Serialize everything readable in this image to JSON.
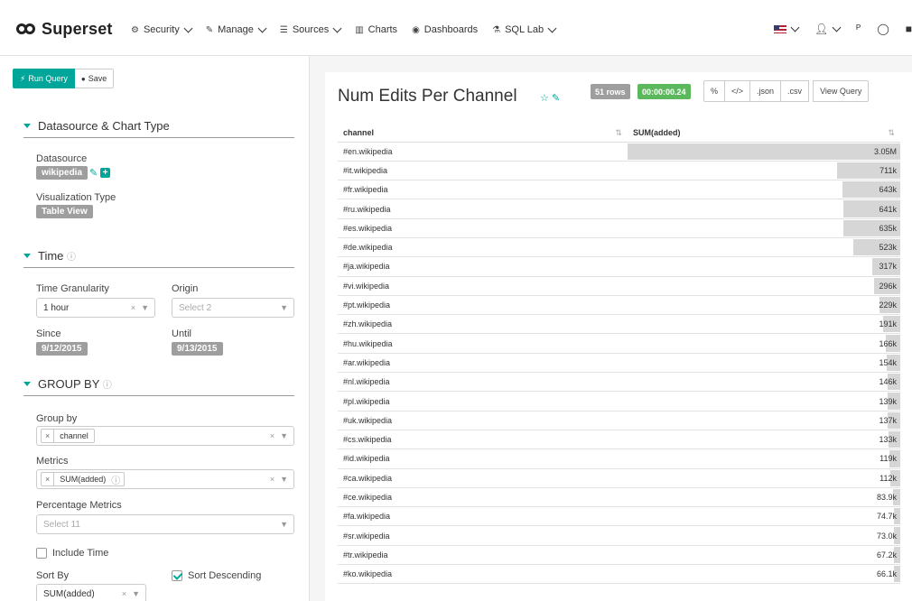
{
  "navbar": {
    "brand": "Superset",
    "items": [
      {
        "icon": "gear-icon",
        "glyph": "⚙",
        "label": "Security",
        "dropdown": true
      },
      {
        "icon": "wrench-icon",
        "glyph": "✎",
        "label": "Manage",
        "dropdown": true
      },
      {
        "icon": "database-icon",
        "glyph": "☰",
        "label": "Sources",
        "dropdown": true
      },
      {
        "icon": "bar-chart-icon",
        "glyph": "▥",
        "label": "Charts",
        "dropdown": false
      },
      {
        "icon": "dashboard-icon",
        "glyph": "◉",
        "label": "Dashboards",
        "dropdown": false
      },
      {
        "icon": "flask-icon",
        "glyph": "⚗",
        "label": "SQL Lab",
        "dropdown": true
      }
    ]
  },
  "left": {
    "run_query": "Run Query",
    "save": "Save",
    "datasource_section": "Datasource & Chart Type",
    "datasource_label": "Datasource",
    "datasource_value": "wikipedia",
    "viz_type_label": "Visualization Type",
    "viz_type_value": "Table View",
    "time_section": "Time",
    "time_granularity_label": "Time Granularity",
    "time_granularity_value": "1 hour",
    "origin_label": "Origin",
    "origin_placeholder": "Select 2",
    "since_label": "Since",
    "since_value": "9/12/2015",
    "until_label": "Until",
    "until_value": "9/13/2015",
    "groupby_section": "GROUP BY",
    "groupby_label": "Group by",
    "groupby_value": "channel",
    "metrics_label": "Metrics",
    "metrics_value": "SUM(added)",
    "pct_metrics_label": "Percentage Metrics",
    "pct_metrics_placeholder": "Select 11",
    "include_time": "Include Time",
    "sort_by_label": "Sort By",
    "sort_by_value": "SUM(added)",
    "sort_desc": "Sort Descending"
  },
  "chart": {
    "title": "Num Edits Per Channel",
    "rows_badge": "51 rows",
    "time_badge": "00:00:00.24",
    "buttons": [
      "%",
      "</>",
      ".json",
      ".csv",
      "View Query"
    ],
    "columns": [
      "channel",
      "SUM(added)"
    ],
    "rows": [
      {
        "channel": "#en.wikipedia",
        "value": "3.05M",
        "num": 3050000
      },
      {
        "channel": "#it.wikipedia",
        "value": "711k",
        "num": 711000
      },
      {
        "channel": "#fr.wikipedia",
        "value": "643k",
        "num": 643000
      },
      {
        "channel": "#ru.wikipedia",
        "value": "641k",
        "num": 641000
      },
      {
        "channel": "#es.wikipedia",
        "value": "635k",
        "num": 635000
      },
      {
        "channel": "#de.wikipedia",
        "value": "523k",
        "num": 523000
      },
      {
        "channel": "#ja.wikipedia",
        "value": "317k",
        "num": 317000
      },
      {
        "channel": "#vi.wikipedia",
        "value": "296k",
        "num": 296000
      },
      {
        "channel": "#pt.wikipedia",
        "value": "229k",
        "num": 229000
      },
      {
        "channel": "#zh.wikipedia",
        "value": "191k",
        "num": 191000
      },
      {
        "channel": "#hu.wikipedia",
        "value": "166k",
        "num": 166000
      },
      {
        "channel": "#ar.wikipedia",
        "value": "154k",
        "num": 154000
      },
      {
        "channel": "#nl.wikipedia",
        "value": "146k",
        "num": 146000
      },
      {
        "channel": "#pl.wikipedia",
        "value": "139k",
        "num": 139000
      },
      {
        "channel": "#uk.wikipedia",
        "value": "137k",
        "num": 137000
      },
      {
        "channel": "#cs.wikipedia",
        "value": "133k",
        "num": 133000
      },
      {
        "channel": "#id.wikipedia",
        "value": "119k",
        "num": 119000
      },
      {
        "channel": "#ca.wikipedia",
        "value": "112k",
        "num": 112000
      },
      {
        "channel": "#ce.wikipedia",
        "value": "83.9k",
        "num": 83900
      },
      {
        "channel": "#fa.wikipedia",
        "value": "74.7k",
        "num": 74700
      },
      {
        "channel": "#sr.wikipedia",
        "value": "73.0k",
        "num": 73000
      },
      {
        "channel": "#tr.wikipedia",
        "value": "67.2k",
        "num": 67200
      },
      {
        "channel": "#ko.wikipedia",
        "value": "66.1k",
        "num": 66100
      }
    ]
  },
  "colors": {
    "accent": "#00a699",
    "bar": "#d6d6d6",
    "time_badge": "#5cb85c"
  }
}
